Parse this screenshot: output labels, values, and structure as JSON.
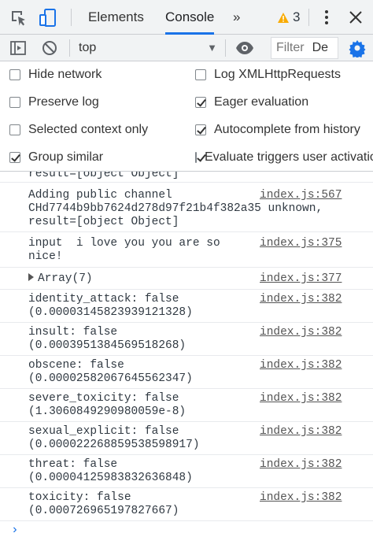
{
  "tabs": {
    "elements": "Elements",
    "console": "Console",
    "more": "»",
    "warning_count": "3"
  },
  "console_toolbar": {
    "context": "top",
    "filter_placeholder": "Filter",
    "filter_value": "De"
  },
  "settings": {
    "left": [
      {
        "label": "Hide network",
        "checked": false
      },
      {
        "label": "Preserve log",
        "checked": false
      },
      {
        "label": "Selected context only",
        "checked": false
      },
      {
        "label": "Group similar",
        "checked": true
      }
    ],
    "right": [
      {
        "label": "Log XMLHttpRequests",
        "checked": false
      },
      {
        "label": "Eager evaluation",
        "checked": true
      },
      {
        "label": "Autocomplete from history",
        "checked": true
      },
      {
        "label": "Evaluate triggers user activation",
        "checked": true
      }
    ]
  },
  "log": {
    "partial_top": "result=[object Object]",
    "messages": [
      {
        "lines": [
          "Adding public channel",
          "CHd7744b9bb7624d278d97f21b4f382a35 unknown,",
          "result=[object Object]"
        ],
        "source": "index.js:567"
      },
      {
        "lines": [
          "input  i love you you are so",
          "nice!"
        ],
        "source": "index.js:375"
      },
      {
        "lines": [
          "Array(7)"
        ],
        "source": "index.js:377",
        "expandable": true
      },
      {
        "lines": [
          "identity_attack: false",
          "(0.00003145823939121328)"
        ],
        "source": "index.js:382"
      },
      {
        "lines": [
          "insult: false",
          "(0.0003951384569518268)"
        ],
        "source": "index.js:382"
      },
      {
        "lines": [
          "obscene: false",
          "(0.00002582067645562347)"
        ],
        "source": "index.js:382"
      },
      {
        "lines": [
          "severe_toxicity: false",
          "(1.3060849290980059e-8)"
        ],
        "source": "index.js:382"
      },
      {
        "lines": [
          "sexual_explicit: false",
          "(0.000022268859538598917)"
        ],
        "source": "index.js:382"
      },
      {
        "lines": [
          "threat: false",
          "(0.00004125983832636848)"
        ],
        "source": "index.js:382"
      },
      {
        "lines": [
          "toxicity: false",
          "(0.000726965197827667)"
        ],
        "source": "index.js:382"
      }
    ],
    "prompt": "›"
  }
}
